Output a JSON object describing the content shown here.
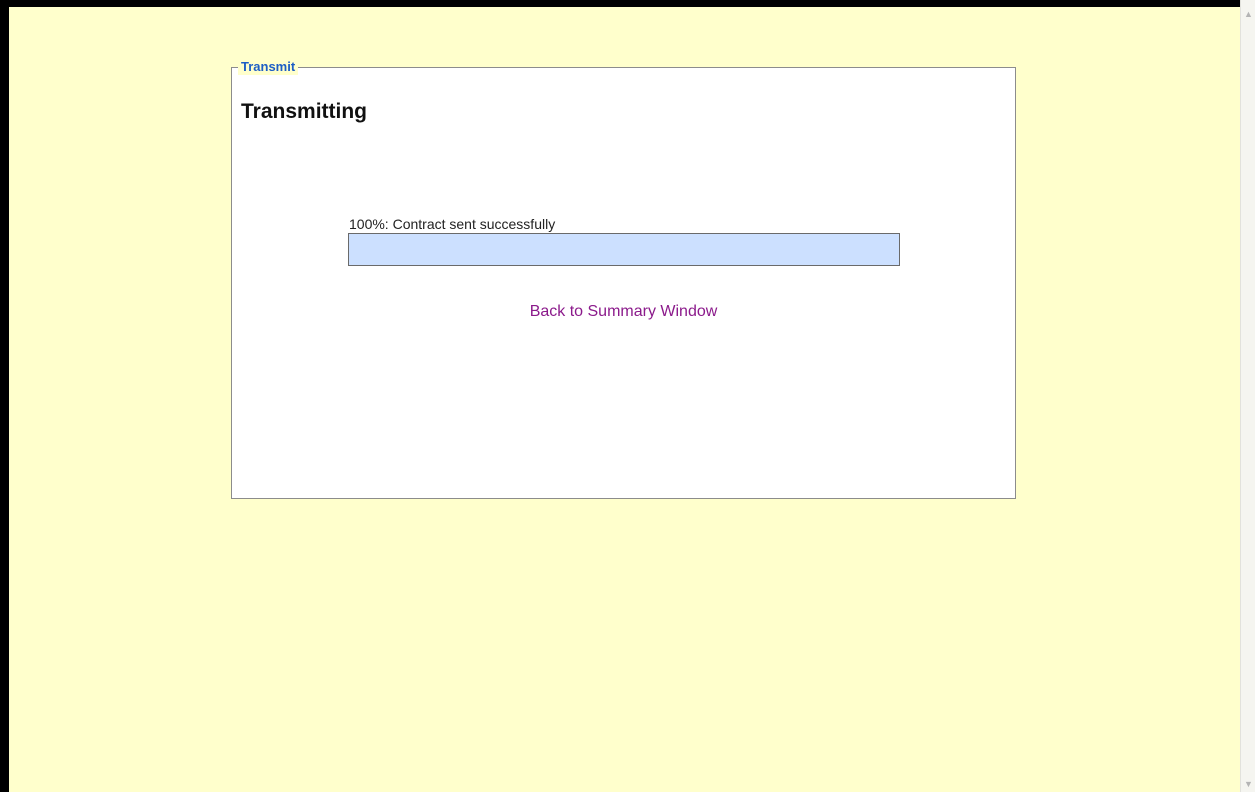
{
  "panel": {
    "legend": "Transmit",
    "title": "Transmitting",
    "progress": {
      "label": "100%: Contract sent successfully",
      "percent": 100
    },
    "back_link": "Back to Summary Window"
  },
  "colors": {
    "page_background": "#ffffcc",
    "legend_text": "#1d5ec5",
    "progress_fill": "#cce0ff",
    "link": "#8b1a8b"
  },
  "icons": {
    "scroll_up": "chevron-up-icon",
    "scroll_down": "chevron-down-icon"
  }
}
